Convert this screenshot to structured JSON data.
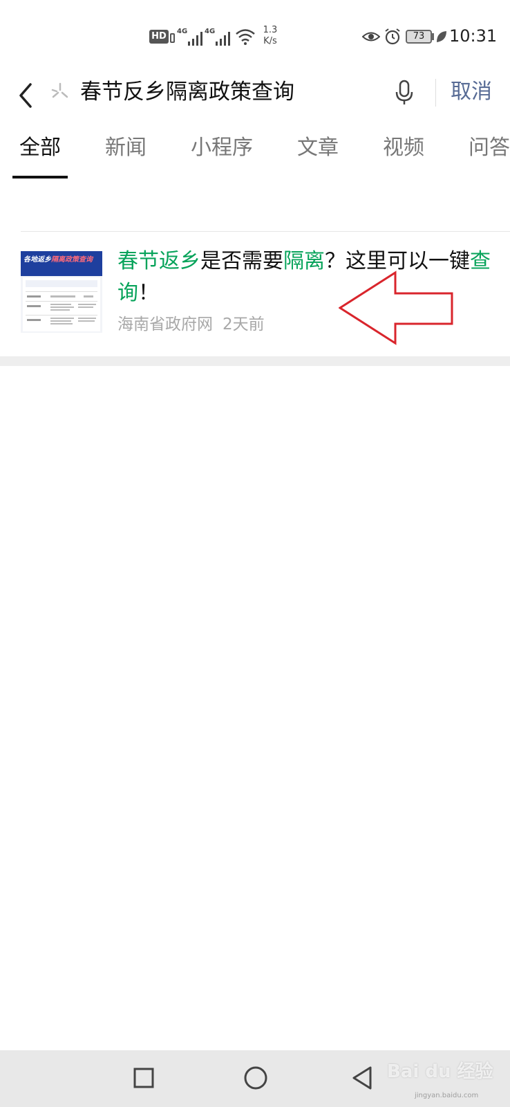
{
  "status_bar": {
    "hd_label": "HD",
    "signal1": "4G",
    "signal2": "4G",
    "speed_value": "1.3",
    "speed_unit": "K/s",
    "battery": "73",
    "time": "10:31"
  },
  "search": {
    "query": "春节反乡隔离政策查询",
    "cancel_label": "取消"
  },
  "tabs": [
    {
      "label": "全部",
      "active": true
    },
    {
      "label": "新闻",
      "active": false
    },
    {
      "label": "小程序",
      "active": false
    },
    {
      "label": "文章",
      "active": false
    },
    {
      "label": "视频",
      "active": false
    },
    {
      "label": "问答",
      "active": false
    }
  ],
  "result": {
    "title_parts": [
      {
        "text": "春节返乡",
        "highlight": true
      },
      {
        "text": "是否需要",
        "highlight": false
      },
      {
        "text": "隔离",
        "highlight": true
      },
      {
        "text": "？这里可以一键",
        "highlight": false
      },
      {
        "text": "查询",
        "highlight": true
      },
      {
        "text": "！",
        "highlight": false
      }
    ],
    "source": "海南省政府网",
    "time": "2天前",
    "thumb_text_a": "各地返乡",
    "thumb_text_b": "隔离政策查询"
  },
  "colors": {
    "highlight": "#07a35a",
    "cancel": "#576b95",
    "annotation_arrow": "#d9252c"
  },
  "watermark": {
    "brand": "Bai du 经验",
    "url": "jingyan.baidu.com"
  }
}
